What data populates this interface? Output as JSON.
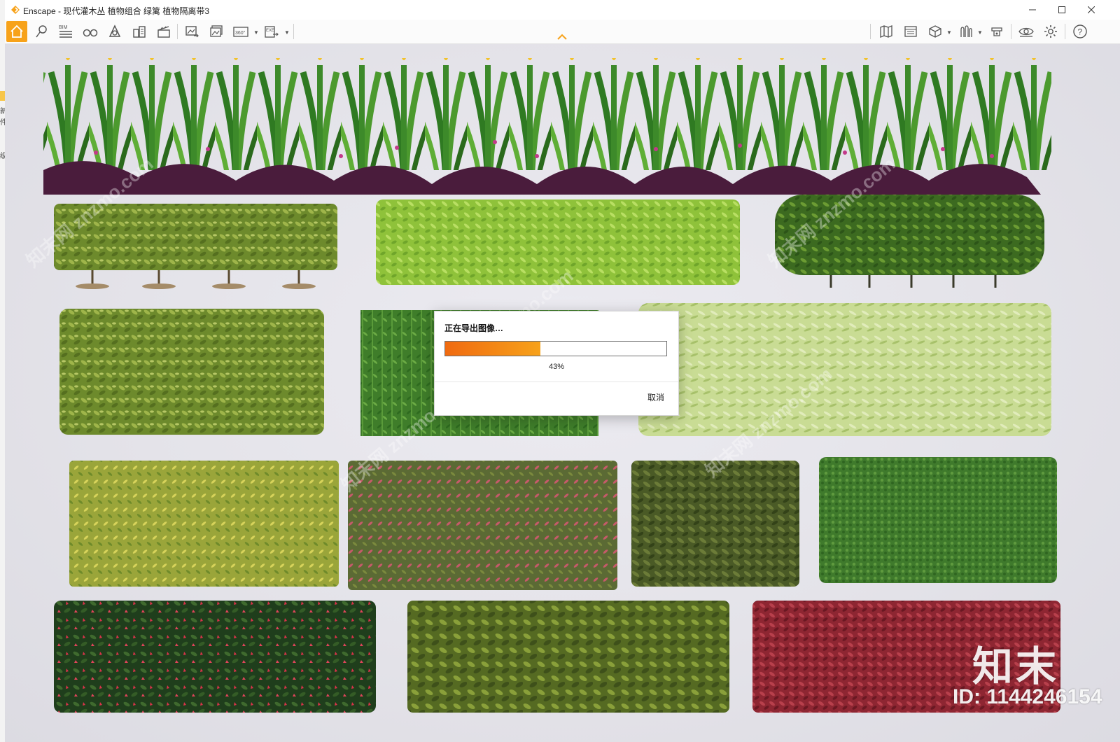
{
  "window": {
    "title": "Enscape - 现代灌木丛 植物组合 绿篱 植物隔离带3",
    "brand_color": "#f7a21a"
  },
  "title_controls": [
    "minimize-icon",
    "maximize-icon",
    "close-icon"
  ],
  "toolbar": {
    "left_items": [
      {
        "name": "home-icon",
        "active": true
      },
      {
        "name": "location-pin-icon"
      },
      {
        "name": "bim-icon",
        "label": "BIM"
      },
      {
        "name": "binoculars-icon"
      },
      {
        "name": "light-icon"
      },
      {
        "name": "buildings-icon"
      },
      {
        "name": "clapper-icon"
      },
      {
        "name": "export-image-icon"
      },
      {
        "name": "batch-render-icon"
      },
      {
        "name": "panorama-360-icon",
        "label": "360°"
      },
      {
        "name": "export-exe-icon",
        "label": "EXE"
      }
    ],
    "right_items": [
      {
        "name": "map-icon"
      },
      {
        "name": "visual-settings-icon"
      },
      {
        "name": "cube-icon"
      },
      {
        "name": "asset-library-icon"
      },
      {
        "name": "material-editor-icon"
      },
      {
        "name": "eye-icon"
      },
      {
        "name": "gear-icon"
      },
      {
        "name": "help-icon",
        "label": "?"
      }
    ]
  },
  "dialog": {
    "title": "正在导出图像…",
    "progress_percent": 43,
    "progress_label": "43%",
    "cancel_label": "取消"
  },
  "watermark": {
    "logo_text": "知末",
    "id_text": "ID: 1144246154"
  },
  "host_strip_marks": [
    "新",
    "件",
    "级"
  ]
}
